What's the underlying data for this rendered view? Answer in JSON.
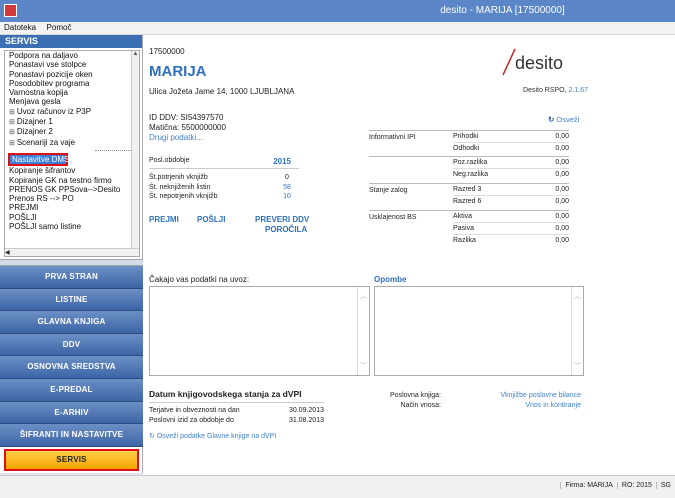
{
  "window": {
    "title": "desito - MARIJA [17500000]"
  },
  "menu": [
    "Datoteka",
    "Pomoč"
  ],
  "sidebar": {
    "header": "SERVIS",
    "items": [
      {
        "label": "Podpora na daljavo",
        "exp": false
      },
      {
        "label": "Ponastavi vse stolpce",
        "exp": false
      },
      {
        "label": "Ponastavi pozicije oken",
        "exp": false
      },
      {
        "label": "Posodobitev programa",
        "exp": false
      },
      {
        "label": "Varnostna kopija",
        "exp": false
      },
      {
        "label": "Menjava gesla",
        "exp": false
      },
      {
        "label": "Uvoz računov iz P3P",
        "exp": true
      },
      {
        "label": "Dizajner 1",
        "exp": true
      },
      {
        "label": "Dizajner 2",
        "exp": true
      },
      {
        "label": "Scenariji za vaje",
        "exp": true
      }
    ],
    "selected": "Nastavitve DMS",
    "items_after": [
      "Kopiranje šifrantov",
      "Kopiranje GK na testno firmo",
      "PRENOS GK PPSova-->Desito",
      "Prenos RS --> PO",
      "PREJMI",
      "POŠLJI",
      "POŠLJI samo listine"
    ],
    "nav": [
      "PRVA STRAN",
      "LISTINE",
      "GLAVNA KNJIGA",
      "DDV",
      "OSNOVNA SREDSTVA",
      "E-PREDAL",
      "E-ARHIV",
      "ŠIFRANTI IN NASTAVITVE"
    ],
    "nav_active": "SERVIS",
    "nav_footer": "»"
  },
  "company": {
    "code": "17500000",
    "name": "MARIJA",
    "address": "Ulica Jožeta Jame 14, 1000 LJUBLJANA",
    "ddv": "ID DDV: SI54397570",
    "maticna": "Matična: 5500000000",
    "more_link": "Drugi podatki..."
  },
  "logo": {
    "text": "desito",
    "subtitle": "Desito RSPO,",
    "version": "2.1.67"
  },
  "refresh_label": "Osveži",
  "stats": {
    "label": "Posl.obdobje",
    "year": "2015",
    "rows": [
      {
        "label": "Št.potrjenih vknjižb",
        "value": "0",
        "colored": false
      },
      {
        "label": "Št. neknjiženih listin",
        "value": "58",
        "colored": true
      },
      {
        "label": "Št. nepotrjenih vknjižb",
        "value": "10",
        "colored": true
      }
    ]
  },
  "actions": {
    "prejmi": "PREJMI",
    "poslji": "POŠLJI",
    "preveri_1": "PREVERI DDV",
    "preveri_2": "POROČILA"
  },
  "financials": [
    {
      "group": "Informativni IPI",
      "rows": [
        {
          "k": "Prihodki",
          "v": "0,00"
        },
        {
          "k": "Odhodki",
          "v": "0,00"
        }
      ]
    },
    {
      "group": "",
      "rows": [
        {
          "k": "Poz.razlika",
          "v": "0,00"
        },
        {
          "k": "Neg.razlika",
          "v": "0,00"
        }
      ]
    },
    {
      "group": "Stanje zalog",
      "rows": [
        {
          "k": "Razred 3",
          "v": "0,00"
        },
        {
          "k": "Razred 6",
          "v": "0,00"
        }
      ]
    },
    {
      "group": "Usklajenost BS",
      "rows": [
        {
          "k": "Aktiva",
          "v": "0,00"
        },
        {
          "k": "Pasiva",
          "v": "0,00"
        },
        {
          "k": "Razlika",
          "v": "0,00"
        }
      ]
    }
  ],
  "import_label": "Čakajo vas podatki na uvoz:",
  "notes_label": "Opombe",
  "datum": {
    "title": "Datum knjigovodskega stanja za dVPI",
    "rows": [
      {
        "k": "Terjatve in obveznosti na dan",
        "v": "30.09.2013"
      },
      {
        "k": "Poslovni izid za obdobje do",
        "v": "31.08.2013"
      }
    ],
    "refresh_link": "Osveži podatke Glavne knjige na dVPI"
  },
  "poslovna": {
    "rows": [
      {
        "k": "Poslovna knjiga:",
        "v": "Vknjižbe poslovne bilance"
      },
      {
        "k": "Način vnosa:",
        "v": "Vnos in kontiranje"
      }
    ]
  },
  "status": [
    "Firma: MARIJA",
    "RO: 2015",
    "SG"
  ]
}
